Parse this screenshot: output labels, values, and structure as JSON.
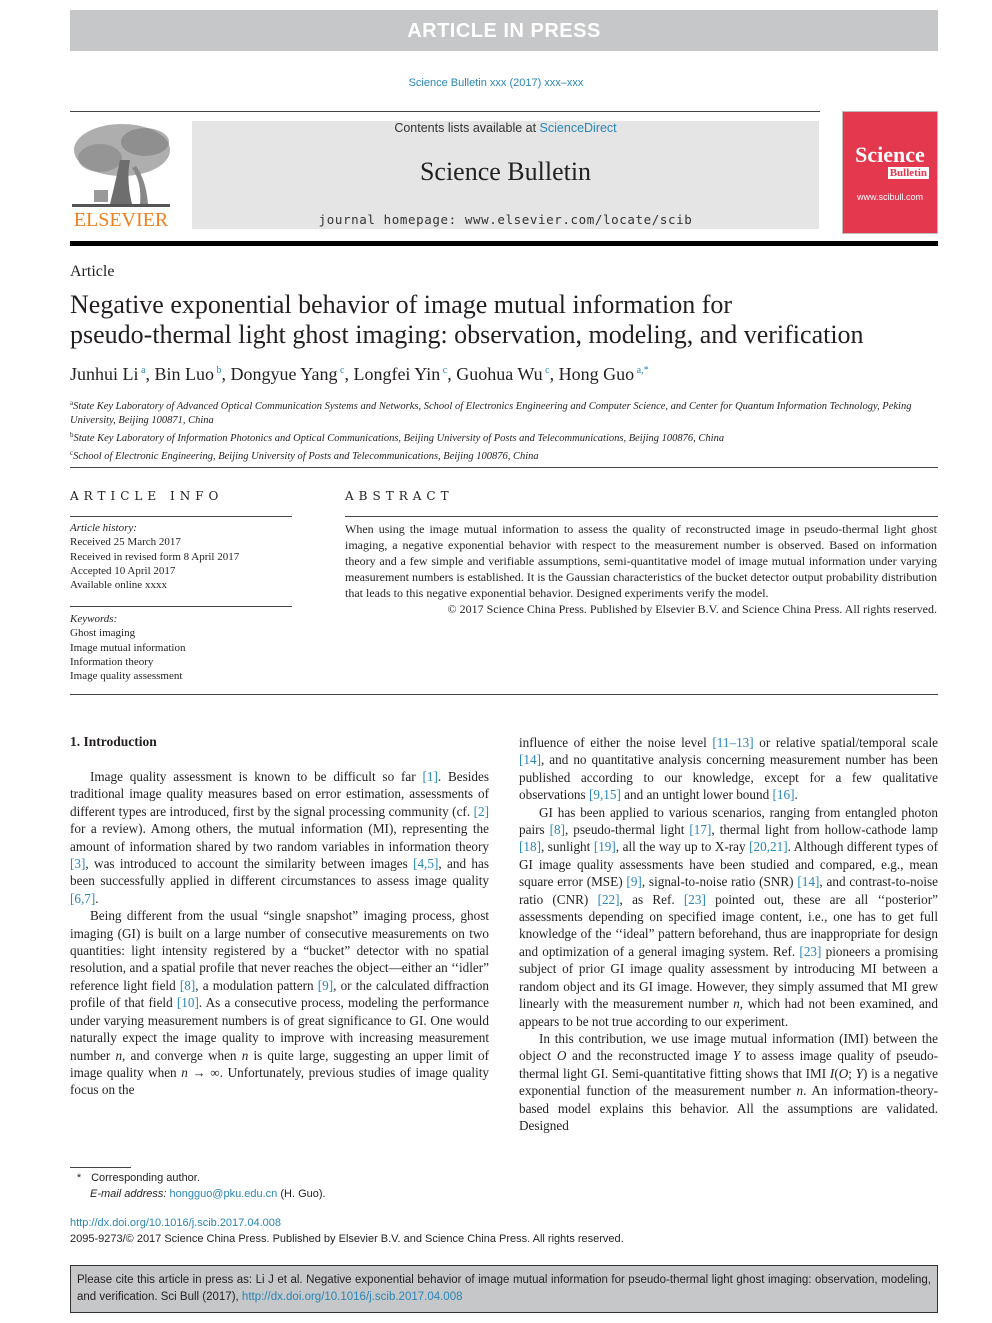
{
  "banner": "ARTICLE IN PRESS",
  "journal_ref": "Science Bulletin xxx (2017) xxx–xxx",
  "header": {
    "publisher_logo_text": "ELSEVIER",
    "contents_prefix": "Contents lists available at ",
    "contents_link": "ScienceDirect",
    "journal_title": "Science Bulletin",
    "homepage_prefix": "journal homepage: ",
    "homepage_url": "www.elsevier.com/locate/scib",
    "cover": {
      "line1": "Science",
      "line2": "Bulletin",
      "url": "www.scibull.com"
    }
  },
  "article_type": "Article",
  "title_line1": "Negative exponential behavior of image mutual information for",
  "title_line2": "pseudo-thermal light ghost imaging: observation, modeling, and verification",
  "authors": [
    {
      "name": "Junhui Li",
      "sup": "a"
    },
    {
      "name": "Bin Luo",
      "sup": "b"
    },
    {
      "name": "Dongyue Yang",
      "sup": "c"
    },
    {
      "name": "Longfei Yin",
      "sup": "c"
    },
    {
      "name": "Guohua Wu",
      "sup": "c"
    },
    {
      "name": "Hong Guo",
      "sup": "a,*"
    }
  ],
  "affiliations": [
    {
      "sup": "a",
      "text": "State Key Laboratory of Advanced Optical Communication Systems and Networks, School of Electronics Engineering and Computer Science, and Center for Quantum Information Technology, Peking University, Beijing 100871, China"
    },
    {
      "sup": "b",
      "text": "State Key Laboratory of Information Photonics and Optical Communications, Beijing University of Posts and Telecommunications, Beijing 100876, China"
    },
    {
      "sup": "c",
      "text": "School of Electronic Engineering, Beijing University of Posts and Telecommunications, Beijing 100876, China"
    }
  ],
  "article_info": {
    "heading": "ARTICLE INFO",
    "history_label": "Article history:",
    "history": [
      "Received 25 March 2017",
      "Received in revised form 8 April 2017",
      "Accepted 10 April 2017",
      "Available online xxxx"
    ],
    "keywords_label": "Keywords:",
    "keywords": [
      "Ghost imaging",
      "Image mutual information",
      "Information theory",
      "Image quality assessment"
    ]
  },
  "abstract": {
    "heading": "ABSTRACT",
    "text": "When using the image mutual information to assess the quality of reconstructed image in pseudo-thermal light ghost imaging, a negative exponential behavior with respect to the measurement number is observed. Based on information theory and a few simple and verifiable assumptions, semi-quantitative model of image mutual information under varying measurement numbers is established. It is the Gaussian characteristics of the bucket detector output probability distribution that leads to this negative exponential behavior. Designed experiments verify the model.",
    "copyright": "© 2017 Science China Press. Published by Elsevier B.V. and Science China Press. All rights reserved."
  },
  "intro": {
    "heading": "1. Introduction",
    "left_paragraphs": [
      [
        "Image quality assessment is known to be difficult so far ",
        {
          "ref": "[1]"
        },
        ". Besides traditional image quality measures based on error estimation, assessments of different types are introduced, first by the signal processing community (cf. ",
        {
          "ref": "[2]"
        },
        " for a review). Among others, the mutual information (MI), representing the amount of information shared by two random variables in information theory ",
        {
          "ref": "[3]"
        },
        ", was introduced to account the similarity between images ",
        {
          "ref": "[4,5]"
        },
        ", and has been successfully applied in different circumstances to assess image quality ",
        {
          "ref": "[6,7]"
        },
        "."
      ],
      [
        "Being different from the usual “single snapshot” imaging process, ghost imaging (GI) is built on a large number of consecutive measurements on two quantities: light intensity registered by a “bucket” detector with no spatial resolution, and a spatial profile that never reaches the object—either an ‘‘idler” reference light field ",
        {
          "ref": "[8]"
        },
        ", a modulation pattern ",
        {
          "ref": "[9]"
        },
        ", or the calculated diffraction profile of that field ",
        {
          "ref": "[10]"
        },
        ". As a consecutive process, modeling the performance under varying measurement numbers is of great significance to GI. One would naturally expect the image quality to improve with increasing measurement number ",
        {
          "em": "n"
        },
        ", and converge when ",
        {
          "em": "n"
        },
        " is quite large, suggesting an upper limit of image quality when ",
        {
          "em": "n"
        },
        " → ∞. Unfortunately, previous studies of image quality focus on the"
      ]
    ],
    "right_paragraphs": [
      [
        "influence of either the noise level ",
        {
          "ref": "[11–13]"
        },
        " or relative spatial/temporal scale ",
        {
          "ref": "[14]"
        },
        ", and no quantitative analysis concerning measurement number has been published according to our knowledge, except for a few qualitative observations ",
        {
          "ref": "[9,15]"
        },
        " and an untight lower bound ",
        {
          "ref": "[16]"
        },
        "."
      ],
      [
        "GI has been applied to various scenarios, ranging from entangled photon pairs ",
        {
          "ref": "[8]"
        },
        ", pseudo-thermal light ",
        {
          "ref": "[17]"
        },
        ", thermal light from hollow-cathode lamp ",
        {
          "ref": "[18]"
        },
        ", sunlight ",
        {
          "ref": "[19]"
        },
        ", all the way up to X-ray ",
        {
          "ref": "[20,21]"
        },
        ". Although different types of GI image quality assessments have been studied and compared, e.g., mean square error (MSE) ",
        {
          "ref": "[9]"
        },
        ", signal-to-noise ratio (SNR) ",
        {
          "ref": "[14]"
        },
        ", and contrast-to-noise ratio (CNR) ",
        {
          "ref": "[22]"
        },
        ", as Ref. ",
        {
          "ref": "[23]"
        },
        " pointed out, these are all ‘‘posterior” assessments depending on specified image content, i.e., one has to get full knowledge of the ‘‘ideal” pattern beforehand, thus are inappropriate for design and optimization of a general imaging system. Ref. ",
        {
          "ref": "[23]"
        },
        " pioneers a promising subject of prior GI image quality assessment by introducing MI between a random object and its GI image. However, they simply assumed that MI grew linearly with the measurement number ",
        {
          "em": "n"
        },
        ", which had not been examined, and appears to be not true according to our experiment."
      ],
      [
        "In this contribution, we use image mutual information (IMI) between the object ",
        {
          "em": "O"
        },
        " and the reconstructed image ",
        {
          "em": "Y"
        },
        " to assess image quality of pseudo-thermal light GI. Semi-quantitative fitting shows that IMI ",
        {
          "em": "I"
        },
        "(",
        {
          "em": "O"
        },
        "; ",
        {
          "em": "Y"
        },
        ") is a negative exponential function of the measurement number ",
        {
          "em": "n"
        },
        ". An information-theory-based model explains this behavior. All the assumptions are validated. Designed"
      ]
    ]
  },
  "footnote": {
    "star": "*",
    "corresponding": "Corresponding author.",
    "email_label": "E-mail address:",
    "email": "hongguo@pku.edu.cn",
    "email_suffix": " (H. Guo)."
  },
  "doi": "http://dx.doi.org/10.1016/j.scib.2017.04.008",
  "issn_line": "2095-9273/© 2017 Science China Press. Published by Elsevier B.V. and Science China Press. All rights reserved.",
  "cite_box": {
    "text": "Please cite this article in press as: Li J et al. Negative exponential behavior of image mutual information for pseudo-thermal light ghost imaging: observation, modeling, and verification. Sci Bull (2017), ",
    "link": "http://dx.doi.org/10.1016/j.scib.2017.04.008"
  },
  "colors": {
    "link": "#2a86b6",
    "banner_bg": "#c6c7c8",
    "cover_bg": "#e4384f",
    "elsevier_orange": "#f07f1f"
  }
}
